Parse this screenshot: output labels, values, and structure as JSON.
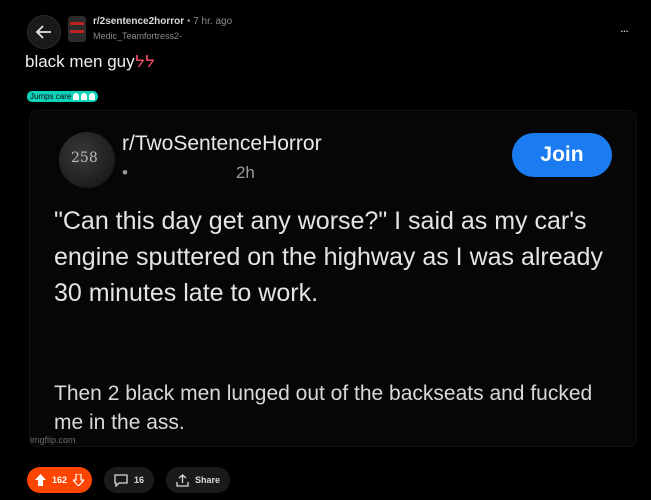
{
  "header": {
    "subreddit": "r/2sentence2horror",
    "age": "• 7 hr. ago",
    "username": "Medic_Teamfortress2-",
    "more": "..."
  },
  "post": {
    "title": "black men guy",
    "title_emoji": "ᔭᔭ",
    "flair": "Jumps care"
  },
  "embed": {
    "avatar_text": "258",
    "subreddit": "r/TwoSentenceHorror",
    "time": "2h",
    "time_dot": "•",
    "join_label": "Join",
    "body_paragraph_1": "\"Can this day get any worse?\" I said as my car's engine sputtered on the highway as I was already 30 minutes late to work.",
    "body_paragraph_2": "Then 2 black men lunged out of the backseats and fucked me in the ass.",
    "watermark": "imgflip.com"
  },
  "actions": {
    "upvotes": "162",
    "comments": "16",
    "share": "Share"
  },
  "colors": {
    "upvote": "#ff4500",
    "join": "#1a7cf0",
    "flair": "#0dd3bb"
  }
}
